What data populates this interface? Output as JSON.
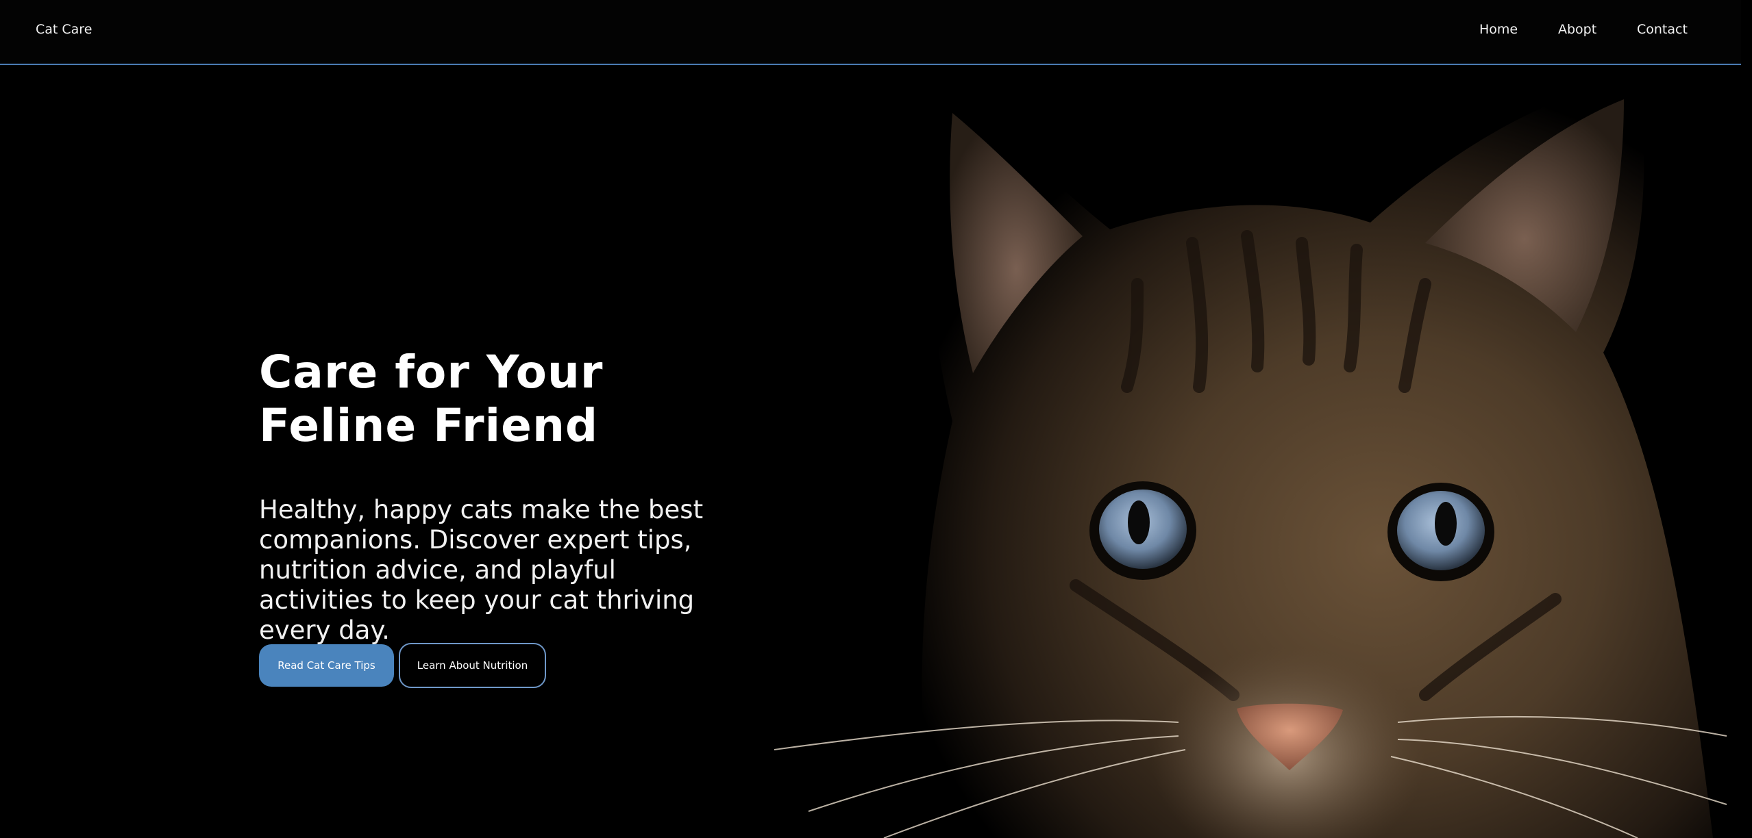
{
  "nav": {
    "brand": "Cat Care",
    "links": [
      {
        "label": "Home"
      },
      {
        "label": "Abopt"
      },
      {
        "label": "Contact"
      }
    ]
  },
  "hero": {
    "title": "Care for Your Feline Friend",
    "subtitle": "Healthy, happy cats make the best companions. Discover expert tips, nutrition advice, and playful activities to keep your cat thriving every day.",
    "primary_button": "Read Cat Care Tips",
    "secondary_button": "Learn About Nutrition"
  },
  "colors": {
    "background": "#000000",
    "accent": "#4a84bd",
    "nav_border": "#4a7bb3"
  }
}
